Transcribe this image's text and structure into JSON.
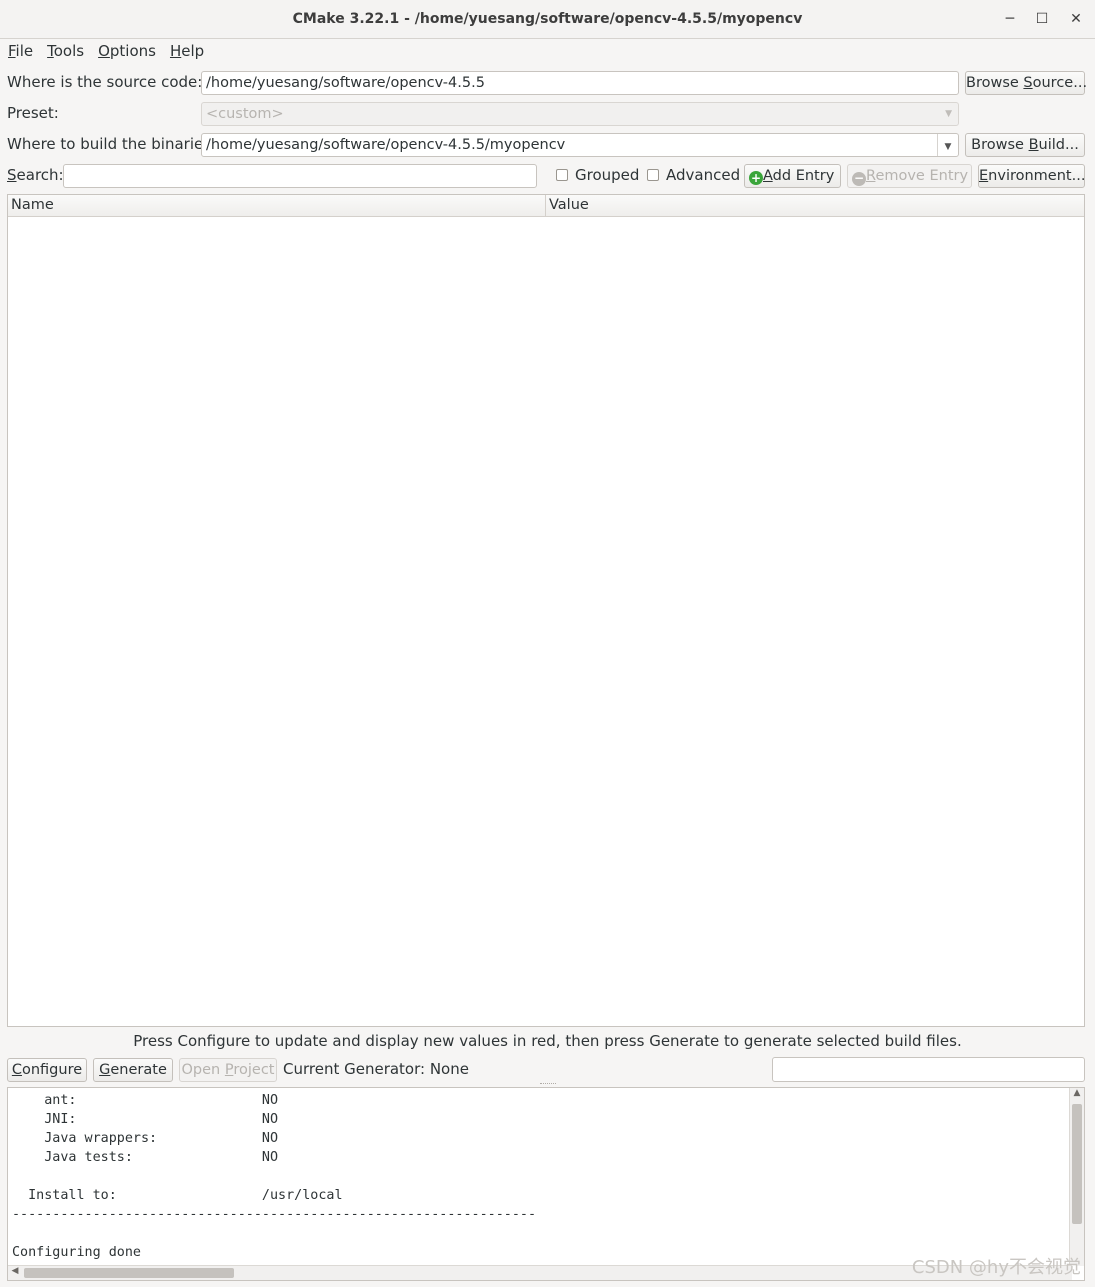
{
  "window": {
    "title": "CMake 3.22.1 - /home/yuesang/software/opencv-4.5.5/myopencv",
    "minimize_symbol": "─",
    "maximize_symbol": "☐",
    "close_symbol": "✕"
  },
  "menubar": {
    "items": [
      {
        "prefix": "",
        "mnemonic": "F",
        "rest": "ile"
      },
      {
        "prefix": "",
        "mnemonic": "T",
        "rest": "ools"
      },
      {
        "prefix": "",
        "mnemonic": "O",
        "rest": "ptions"
      },
      {
        "prefix": "",
        "mnemonic": "H",
        "rest": "elp"
      }
    ]
  },
  "source": {
    "label": "Where is the source code:",
    "value": "/home/yuesang/software/opencv-4.5.5",
    "browse_prefix": "Browse ",
    "browse_mnemonic": "S",
    "browse_rest": "ource..."
  },
  "preset": {
    "label": "Preset:",
    "value": "<custom>"
  },
  "build": {
    "label": "Where to build the binaries:",
    "value": "/home/yuesang/software/opencv-4.5.5/myopencv",
    "browse_prefix": "Browse ",
    "browse_mnemonic": "B",
    "browse_rest": "uild..."
  },
  "search": {
    "label_mnemonic": "S",
    "label_rest": "earch:",
    "value": ""
  },
  "options": {
    "grouped_label": "Grouped",
    "advanced_label": "Advanced",
    "grouped_checked": false,
    "advanced_checked": false
  },
  "entries": {
    "add_mnemonic": "A",
    "add_rest": "dd Entry",
    "remove_mnemonic": "R",
    "remove_rest": "emove Entry",
    "environment_prefix": "",
    "environment_mnemonic": "E",
    "environment_rest": "nvironment..."
  },
  "table": {
    "columns": [
      "Name",
      "Value"
    ],
    "rows": []
  },
  "hint": "Press Configure to update and display new values in red, then press Generate to generate selected build files.",
  "actions": {
    "configure_mnemonic": "C",
    "configure_rest": "onfigure",
    "generate_mnemonic": "G",
    "generate_rest": "enerate",
    "open_project_prefix": "Open ",
    "open_project_mnemonic": "P",
    "open_project_rest": "roject",
    "current_generator": "Current Generator: None"
  },
  "output": {
    "lines": [
      "    ant:                       NO",
      "    JNI:                       NO",
      "    Java wrappers:             NO",
      "    Java tests:                NO",
      "",
      "  Install to:                  /usr/local",
      "-----------------------------------------------------------------",
      "",
      "Configuring done"
    ]
  },
  "watermark": "CSDN @hy不会视觉"
}
